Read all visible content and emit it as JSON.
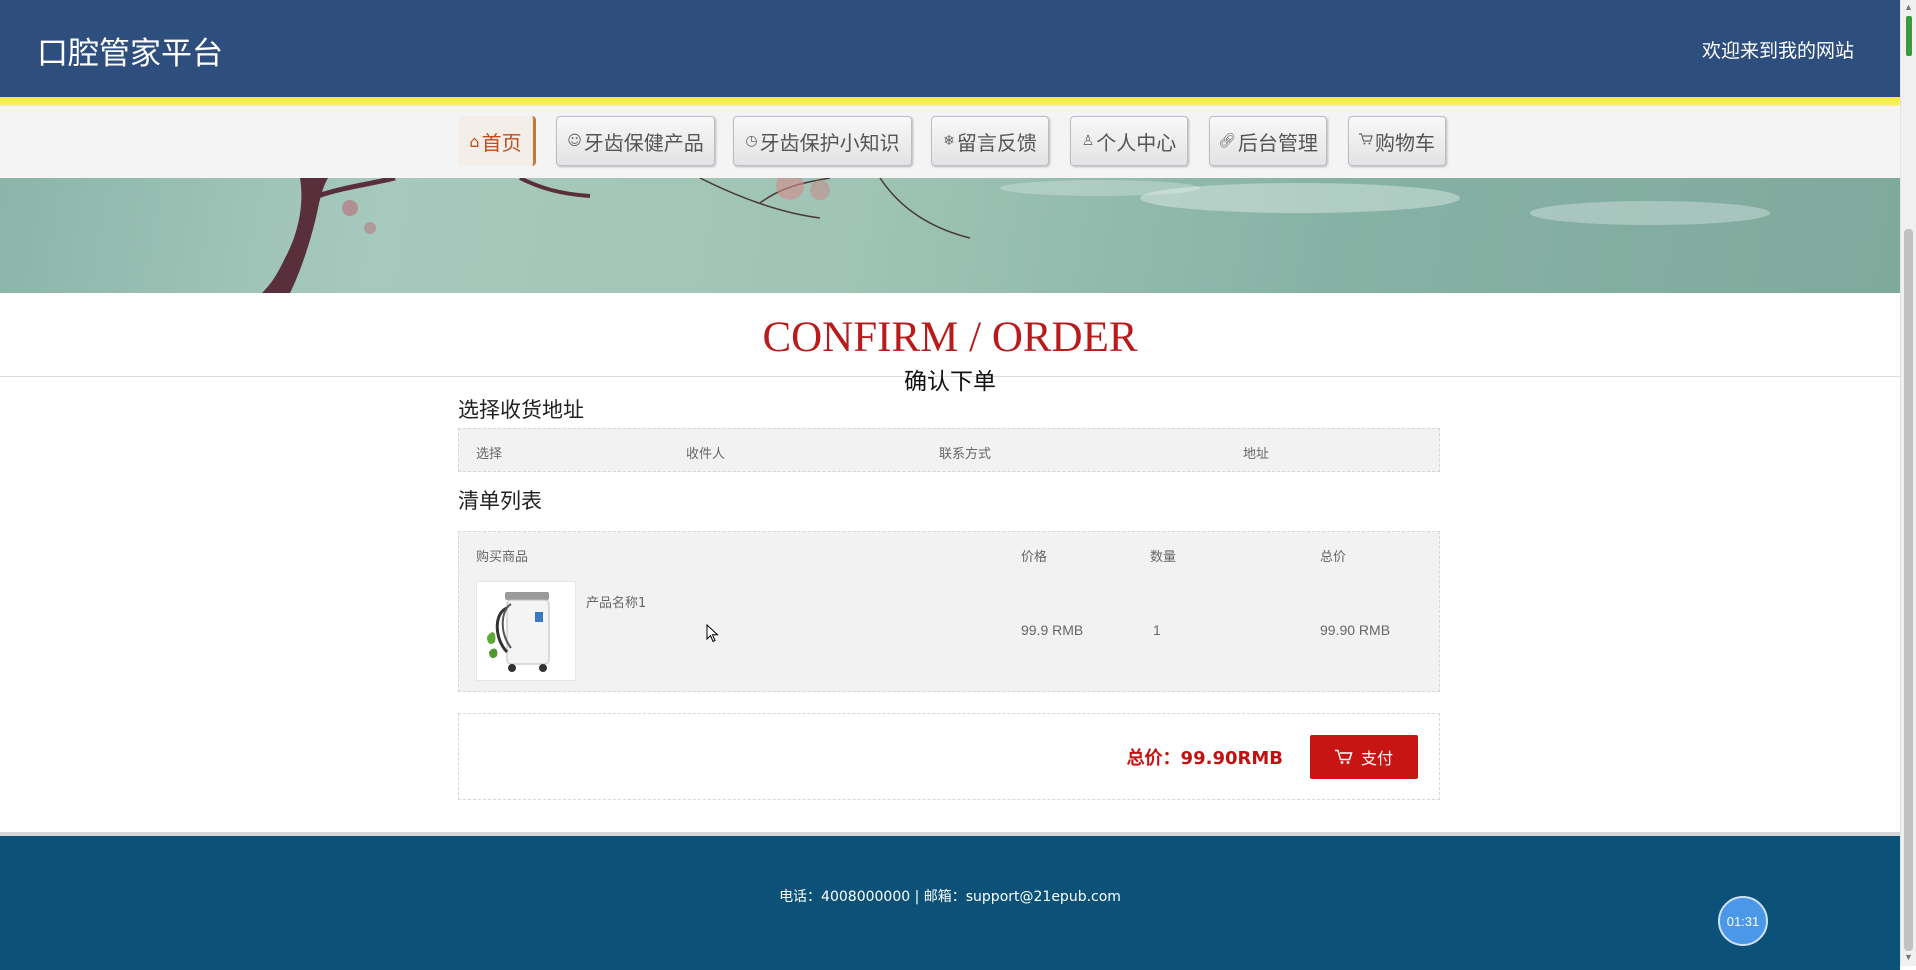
{
  "header": {
    "site_title": "口腔管家平台",
    "welcome": "欢迎来到我的网站"
  },
  "nav": [
    {
      "label": "首页",
      "icon": "home-icon",
      "active": true
    },
    {
      "label": "牙齿保健产品",
      "icon": "smile-icon",
      "active": false
    },
    {
      "label": "牙齿保护小知识",
      "icon": "clock-icon",
      "active": false
    },
    {
      "label": "留言反馈",
      "icon": "snowflake-icon",
      "active": false
    },
    {
      "label": "个人中心",
      "icon": "user-icon",
      "active": false
    },
    {
      "label": "后台管理",
      "icon": "link-icon",
      "active": false
    },
    {
      "label": "购物车",
      "icon": "cart-icon",
      "active": false
    }
  ],
  "page": {
    "title_en": "CONFIRM / ORDER",
    "title_cn": "确认下单"
  },
  "address_section": {
    "title": "选择收货地址",
    "columns": [
      "选择",
      "收件人",
      "联系方式",
      "地址"
    ]
  },
  "list_section": {
    "title": "清单列表",
    "columns": [
      "购买商品",
      "价格",
      "数量",
      "总价"
    ],
    "items": [
      {
        "name": "产品名称1",
        "price": "99.9 RMB",
        "quantity": "1",
        "subtotal": "99.90 RMB"
      }
    ]
  },
  "summary": {
    "total_label": "总价：99.90RMB",
    "pay_label": "支付"
  },
  "footer": {
    "text": "电话：4008000000 | 邮箱：support@21epub.com"
  },
  "timer": {
    "value": "01:31"
  },
  "colors": {
    "header_bg": "#2e4f7e",
    "accent_red": "#c91414",
    "footer_bg": "#0b5178"
  }
}
